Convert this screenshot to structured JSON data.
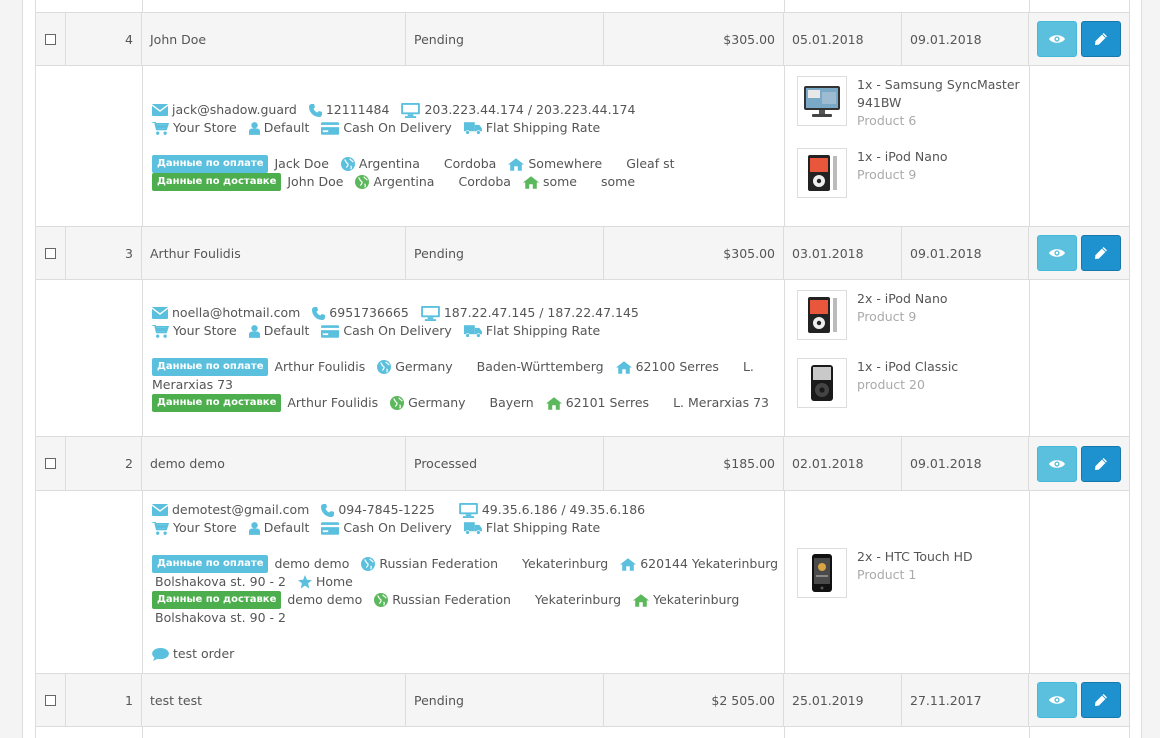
{
  "orders": [
    {
      "id": "4",
      "customer": "John Doe",
      "status": "Pending",
      "total": "$305.00",
      "date_added": "05.01.2018",
      "date_modified": "09.01.2018",
      "email": "jack@shadow.guard",
      "phone": "12111484",
      "ip": "203.223.44.174 / 203.223.44.174",
      "store": "Your Store",
      "group": "Default",
      "payment": "Cash On Delivery",
      "shipping": "Flat Shipping Rate",
      "pay_name": "Jack Doe",
      "pay_country": "Argentina",
      "pay_zone": "Cordoba",
      "pay_city": "Somewhere",
      "pay_address": "Gleaf st",
      "ship_name": "John Doe",
      "ship_country": "Argentina",
      "ship_zone": "Cordoba",
      "ship_city": "some",
      "ship_address": "some",
      "products": [
        {
          "line1": "1x - Samsung SyncMaster",
          "line2": "941BW",
          "model": "Product 6"
        },
        {
          "line1": "1x - iPod Nano",
          "line2": "",
          "model": "Product 9"
        }
      ]
    },
    {
      "id": "3",
      "customer": "Arthur Foulidis",
      "status": "Pending",
      "total": "$305.00",
      "date_added": "03.01.2018",
      "date_modified": "09.01.2018",
      "email": "noella@hotmail.com",
      "phone": "6951736665",
      "ip": "187.22.47.145 / 187.22.47.145",
      "store": "Your Store",
      "group": "Default",
      "payment": "Cash On Delivery",
      "shipping": "Flat Shipping Rate",
      "pay_name": "Arthur Foulidis",
      "pay_country": "Germany",
      "pay_zone": "Baden-Württemberg",
      "pay_city": "62100 Serres",
      "pay_address_a": "L.",
      "pay_address_b": "Merarxias 73",
      "ship_name": "Arthur Foulidis",
      "ship_country": "Germany",
      "ship_zone": "Bayern",
      "ship_city": "62101 Serres",
      "ship_address": "L. Merarxias 73",
      "products": [
        {
          "line1": "2x - iPod Nano",
          "line2": "",
          "model": "Product 9"
        },
        {
          "line1": "1x - iPod Classic",
          "line2": "",
          "model": "product 20"
        }
      ]
    },
    {
      "id": "2",
      "customer": "demo demo",
      "status": "Processed",
      "total": "$185.00",
      "date_added": "02.01.2018",
      "date_modified": "09.01.2018",
      "email": "demotest@gmail.com",
      "phone": "094-7845-1225",
      "ip": "49.35.6.186 / 49.35.6.186",
      "store": "Your Store",
      "group": "Default",
      "payment": "Cash On Delivery",
      "shipping": "Flat Shipping Rate",
      "pay_name": "demo demo",
      "pay_country": "Russian Federation",
      "pay_zone": "Yekaterinburg",
      "pay_city": "620144 Yekaterinburg",
      "pay_address": "Bolshakova st. 90 - 2",
      "pay_tag": "Home",
      "ship_name": "demo demo",
      "ship_country": "Russian Federation",
      "ship_zone": "Yekaterinburg",
      "ship_city": "Yekaterinburg",
      "ship_address": "Bolshakova st. 90 - 2",
      "comment": "test order",
      "products": [
        {
          "line1": "2x - HTC Touch HD",
          "line2": "",
          "model": "Product 1"
        }
      ]
    },
    {
      "id": "1",
      "customer": "test test",
      "status": "Pending",
      "total": "$2 505.00",
      "date_added": "25.01.2019",
      "date_modified": "27.11.2017"
    }
  ],
  "labels": {
    "payment_data": "Данные по оплате",
    "shipping_data": "Данные по доставке"
  },
  "colors": {
    "view_button": "#5bc0de",
    "edit_button": "#1e91cf",
    "payment_label": "#5bc0de",
    "shipping_label": "#4cae4c",
    "icon_blue": "#5bc0de",
    "icon_green": "#5cb85c"
  },
  "icons": {
    "email": "envelope-icon",
    "phone": "phone-icon",
    "ip": "monitor-icon",
    "store": "cart-icon",
    "group": "user-icon",
    "payment": "credit-card-icon",
    "shipping": "truck-icon",
    "country": "globe-icon",
    "city": "home-icon",
    "tag": "star-icon",
    "comment": "comment-icon",
    "view": "eye-icon",
    "edit": "pencil-icon"
  }
}
